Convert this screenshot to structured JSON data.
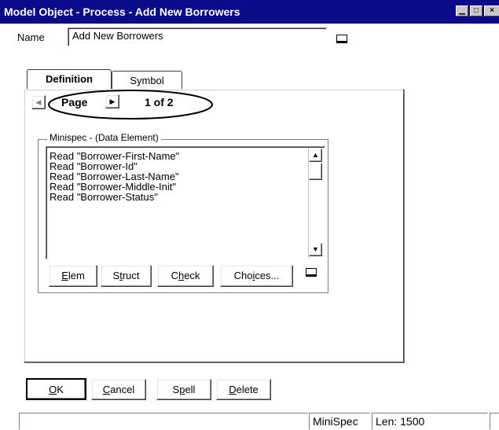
{
  "window": {
    "title": "Model Object - Process - Add New Borrowers"
  },
  "name_field": {
    "label": "Name",
    "value": "Add New Borrowers"
  },
  "tabs": [
    {
      "label": "Definition",
      "active": true
    },
    {
      "label": "Symbol",
      "active": false
    }
  ],
  "pager": {
    "label": "Page",
    "indicator": "1 of 2"
  },
  "minispec": {
    "group_label": "Minispec - (Data Element)",
    "lines": [
      "Read \"Borrower-First-Name\"",
      "Read \"Borrower-Id\"",
      "Read \"Borrower-Last-Name\"",
      "Read \"Borrower-Middle-Init\"",
      "Read \"Borrower-Status\""
    ],
    "buttons": {
      "elem": {
        "pre": "",
        "ul": "E",
        "post": "lem"
      },
      "struct": {
        "pre": "S",
        "ul": "t",
        "post": "ruct"
      },
      "check": {
        "pre": "C",
        "ul": "h",
        "post": "eck"
      },
      "choices": {
        "pre": "Cho",
        "ul": "i",
        "post": "ces..."
      }
    }
  },
  "footer_buttons": {
    "ok": {
      "pre": "",
      "ul": "O",
      "post": "K"
    },
    "cancel": {
      "pre": "",
      "ul": "C",
      "post": "ancel"
    },
    "spell": {
      "pre": "S",
      "ul": "p",
      "post": "ell"
    },
    "delete": {
      "pre": "",
      "ul": "D",
      "post": "elete"
    }
  },
  "statusbar": {
    "mode": "MiniSpec",
    "length": "Len: 1500"
  },
  "colors": {
    "titlebar": "#0b0b8a",
    "background": "#ffffff"
  }
}
